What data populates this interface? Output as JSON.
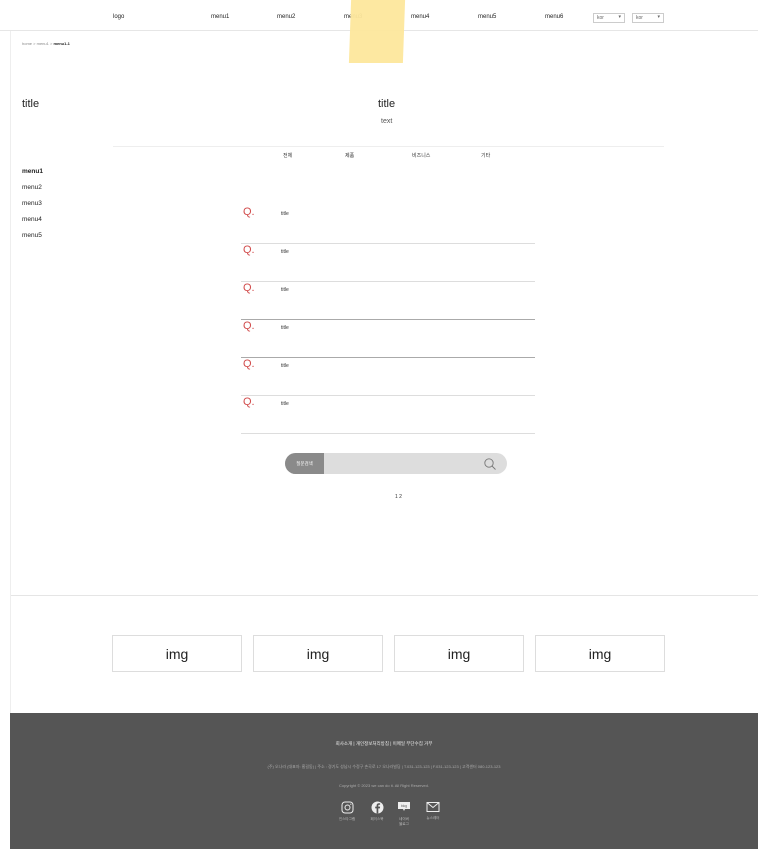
{
  "header": {
    "logo": "logo",
    "menu": [
      "menu1",
      "menu2",
      "menu3",
      "menu4",
      "menu5",
      "menu6"
    ],
    "lang_select_1": "kor",
    "lang_select_2": "kor"
  },
  "breadcrumb": {
    "home": "home",
    "sep1": ">",
    "level1": "menu1",
    "sep2": ">",
    "current": "menu1-1"
  },
  "sidebar": {
    "title": "title",
    "items": [
      {
        "label": "menu1",
        "active": true
      },
      {
        "label": "menu2"
      },
      {
        "label": "menu3"
      },
      {
        "label": "menu4"
      },
      {
        "label": "menu5"
      }
    ]
  },
  "main": {
    "title": "title",
    "text": "text",
    "tabs": [
      "전체",
      "제품",
      "비즈니스",
      "기타"
    ],
    "faq": [
      {
        "q": "Q.",
        "title": "title"
      },
      {
        "q": "Q.",
        "title": "title"
      },
      {
        "q": "Q.",
        "title": "title"
      },
      {
        "q": "Q.",
        "title": "title"
      },
      {
        "q": "Q.",
        "title": "title"
      },
      {
        "q": "Q.",
        "title": "title"
      }
    ],
    "search": {
      "category": "질문검색",
      "value": ""
    },
    "pagination": "1 2"
  },
  "images": [
    "img",
    "img",
    "img",
    "img"
  ],
  "footer": {
    "links": "회사소개 | 개인정보처리방침 | 이메일 무단수집 거부",
    "info": "(주) 오나라 (대표자: 홍길동) | 주소 : 경기도 성남시 수정구 손곡로 17 오나라빌딩 | T.031-123-123 | F.031-123-123 | 고객센터 080-123-123",
    "copyright": "Copyright © 2023 we can do it. All Right Reserved.",
    "social": [
      {
        "icon": "instagram-icon",
        "label": "인스타그램"
      },
      {
        "icon": "facebook-icon",
        "label": "페이스북"
      },
      {
        "icon": "blog-icon",
        "label": "네이버\n블로그"
      },
      {
        "icon": "mail-icon",
        "label": "뉴스레터"
      }
    ]
  },
  "colors": {
    "accent_q": "#d14b4b",
    "footer_bg": "#555555",
    "highlight": "#fde79c"
  }
}
